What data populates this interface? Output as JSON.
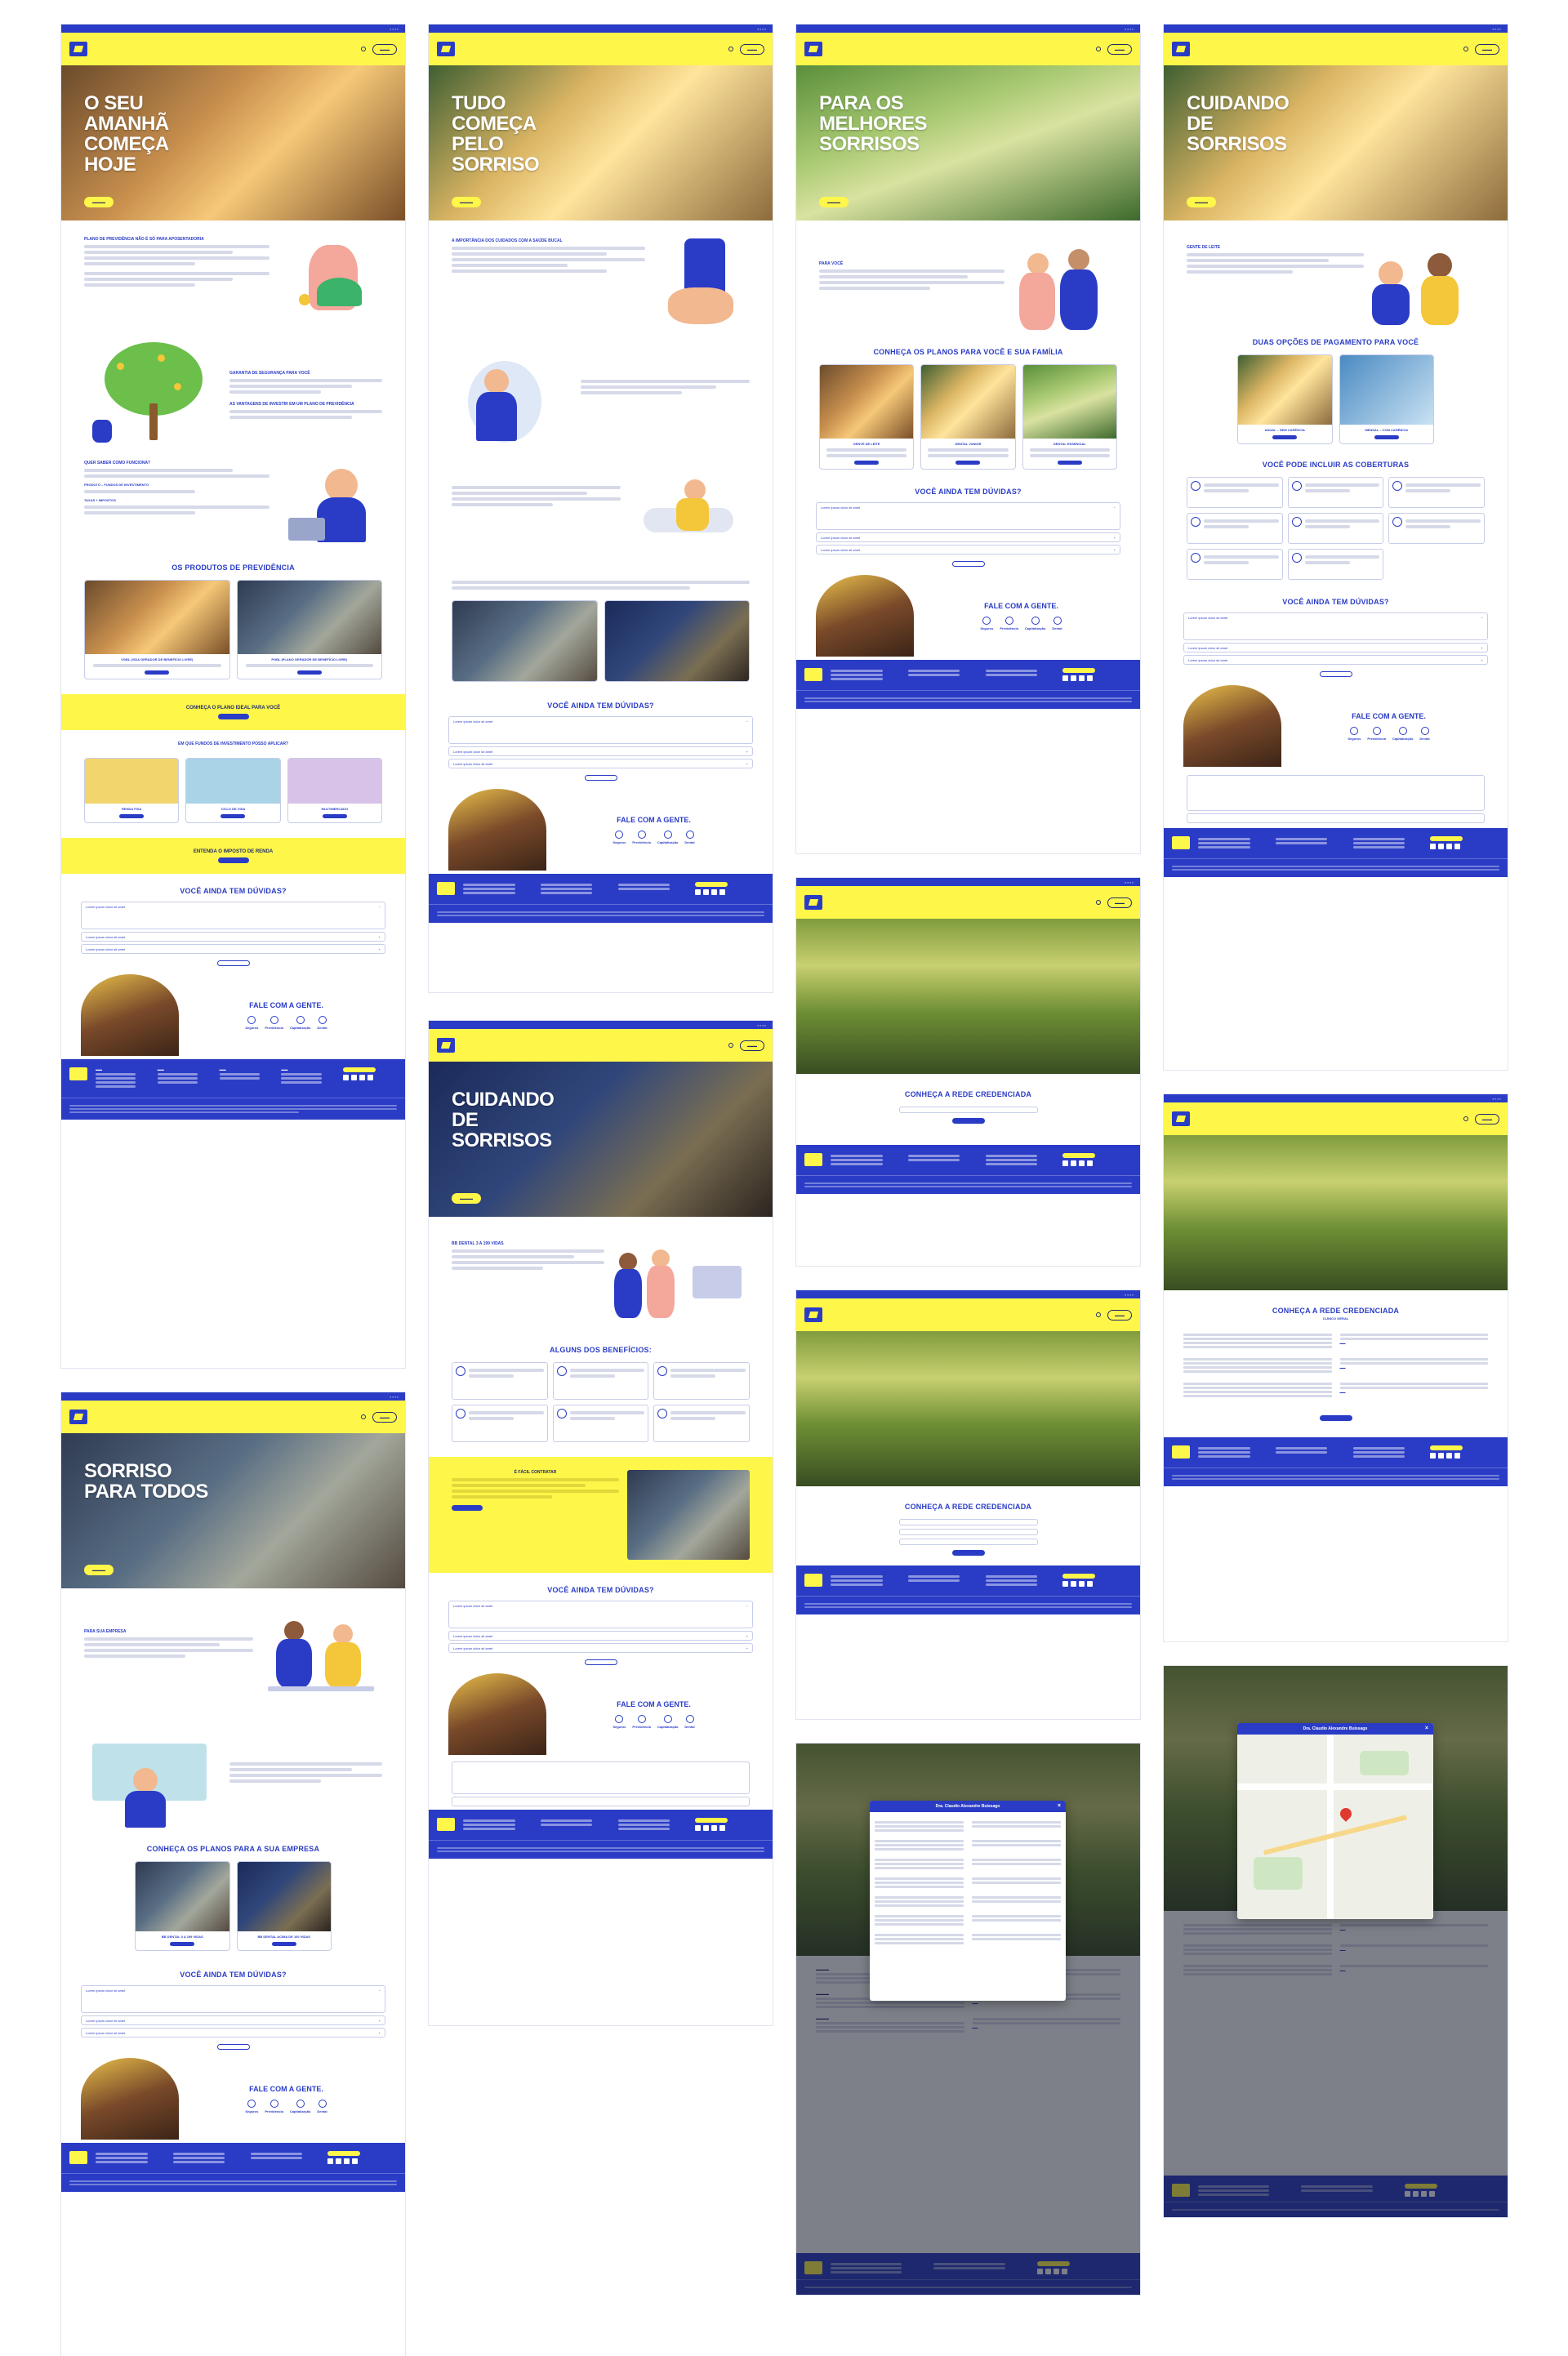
{
  "boards": [
    {
      "id": "previdencia",
      "hero_title": "O SEU AMANHÃ COMEÇA HOJE",
      "sections": {
        "s1": "PLANO DE PREVIDÊNCIA NÃO É SÓ PARA APOSENTADORIA",
        "s2": "GARANTIA DE SEGURANÇA PARA VOCÊ",
        "s3": "AS VANTAGENS DE INVESTIR EM UM PLANO DE PREVIDÊNCIA",
        "s4": "QUER SABER COMO FUNCIONA?",
        "s4a": "PRODUTO – FUNDOS DE INVESTIMENTO",
        "s4b": "TAXAS + IMPOSTOS",
        "products_title": "OS PRODUTOS DE PREVIDÊNCIA",
        "product_a": "VGBL (VIDA GERADOR DE BENEFÍCIO LIVRE)",
        "product_b": "PGBL (PLANO GERADOR DE BENEFÍCIO LIVRE)",
        "band1": "CONHEÇA O PLANO IDEAL PARA VOCÊ",
        "funds_title": "EM QUE FUNDOS DE INVESTIMENTO POSSO APLICAR?",
        "fund_a": "RENDA FIXA",
        "fund_b": "CICLO DE VIDA",
        "fund_c": "MULTIMERCADO",
        "band2": "ENTENDA O IMPOSTO DE RENDA",
        "faq_title": "VOCÊ AINDA TEM DÚVIDAS?",
        "contact_title": "FALE COM A GENTE."
      }
    },
    {
      "id": "dental-1",
      "hero_title": "TUDO COMEÇA PELO SORRISO",
      "sections": {
        "s1": "A IMPORTÂNCIA DOS CUIDADOS COM A SAÚDE BUCAL",
        "faq_title": "VOCÊ AINDA TEM DÚVIDAS?",
        "contact_title": "FALE COM A GENTE."
      }
    },
    {
      "id": "familia",
      "hero_title": "PARA OS MELHORES SORRISOS",
      "sections": {
        "s1": "PARA VOCÊ",
        "plans_title": "CONHEÇA OS PLANOS PARA VOCÊ E SUA FAMÍLIA",
        "plan_a": "GENTE DE LEITE",
        "plan_b": "DENTAL JUNIOR",
        "plan_c": "DENTAL ESSENCIAL",
        "faq_title": "VOCÊ AINDA TEM DÚVIDAS?",
        "contact_title": "FALE COM A GENTE."
      }
    },
    {
      "id": "criancas",
      "hero_title": "CUIDANDO DE SORRISOS",
      "sections": {
        "s1": "GENTE DE LEITE",
        "pay_title": "DUAS OPÇÕES DE PAGAMENTO PARA VOCÊ",
        "pay_a": "ANUAL – SEM CARÊNCIA",
        "pay_b": "MENSAL – COM CARÊNCIA",
        "cov_title": "VOCÊ PODE INCLUIR AS COBERTURAS",
        "faq_title": "VOCÊ AINDA TEM DÚVIDAS?",
        "contact_title": "FALE COM A GENTE."
      }
    },
    {
      "id": "empresa",
      "hero_title": "SORRISO PARA TODOS",
      "sections": {
        "s1": "PARA SUA EMPRESA",
        "plans_title": "CONHEÇA OS PLANOS PARA A SUA EMPRESA",
        "plan_a": "BB DENTAL 3 A 199 VIDAS",
        "plan_b": "BB DENTAL ACIMA DE 100 VIDAS",
        "faq_title": "VOCÊ AINDA TEM DÚVIDAS?",
        "contact_title": "FALE COM A GENTE."
      }
    },
    {
      "id": "dental-2",
      "hero_title": "CUIDANDO DE SORRISOS",
      "sections": {
        "s1": "BB DENTAL 3 A 199 VIDAS",
        "benefits_title": "ALGUNS DOS BENEFÍCIOS:",
        "band": "É FÁCIL CONTRATAR",
        "faq_title": "VOCÊ AINDA TEM DÚVIDAS?",
        "contact_title": "FALE COM A GENTE."
      }
    },
    {
      "id": "rede-1",
      "title": "CONHEÇA A REDE CREDENCIADA"
    },
    {
      "id": "rede-2",
      "title": "CONHEÇA A REDE CREDENCIADA"
    },
    {
      "id": "rede-3",
      "title": "CONHEÇA A REDE CREDENCIADA",
      "subtitle": "CLÍNICO GERAL"
    },
    {
      "id": "rede-modal",
      "modal_title": "Dra. Claudio Alexandre Buissago"
    },
    {
      "id": "rede-map",
      "modal_title": "Dra. Claudio Alexandre Buissago"
    }
  ],
  "contact_links": [
    "Seguros",
    "Previdência",
    "Capitalização",
    "Dental"
  ],
  "faq_items": [
    "Lorem ipsum dolor sit amet",
    "Lorem ipsum dolor sit amet",
    "Lorem ipsum dolor sit amet"
  ],
  "colors": {
    "brand_blue": "#2a3cc6",
    "brand_yellow": "#fff64a"
  }
}
